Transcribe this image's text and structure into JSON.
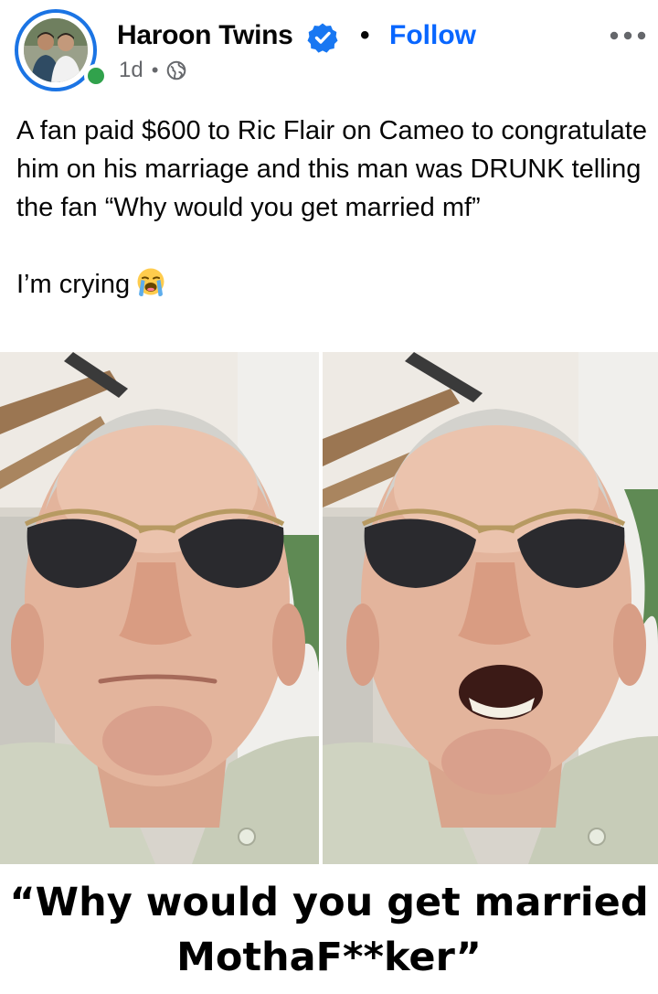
{
  "post": {
    "author": {
      "name": "Haroon Twins",
      "verified_icon": "verified-badge-icon",
      "online": true
    },
    "follow_label": "Follow",
    "separator": "•",
    "timestamp": "1d",
    "audience_icon": "globe-icon",
    "more_icon": "more-options-icon",
    "caption": {
      "paragraph_1": "A fan paid $600 to Ric Flair on Cameo to congratulate him on his marriage and this man was DRUNK telling the fan “Why would you get married mf”",
      "paragraph_2": "I’m crying",
      "emoji_icon": "loudly-crying-face-icon"
    },
    "media": {
      "frames": [
        {
          "description_icon": "man-sunglasses-mouth-closed"
        },
        {
          "description_icon": "man-sunglasses-mouth-open"
        }
      ],
      "meme_caption_line_1": "“Why would you get married",
      "meme_caption_line_2": "MothaF**ker”"
    }
  },
  "colors": {
    "link_blue": "#0866ff",
    "ring_blue": "#1b74e4",
    "online_green": "#31a24c",
    "meta_gray": "#65676b",
    "text": "#050505"
  }
}
